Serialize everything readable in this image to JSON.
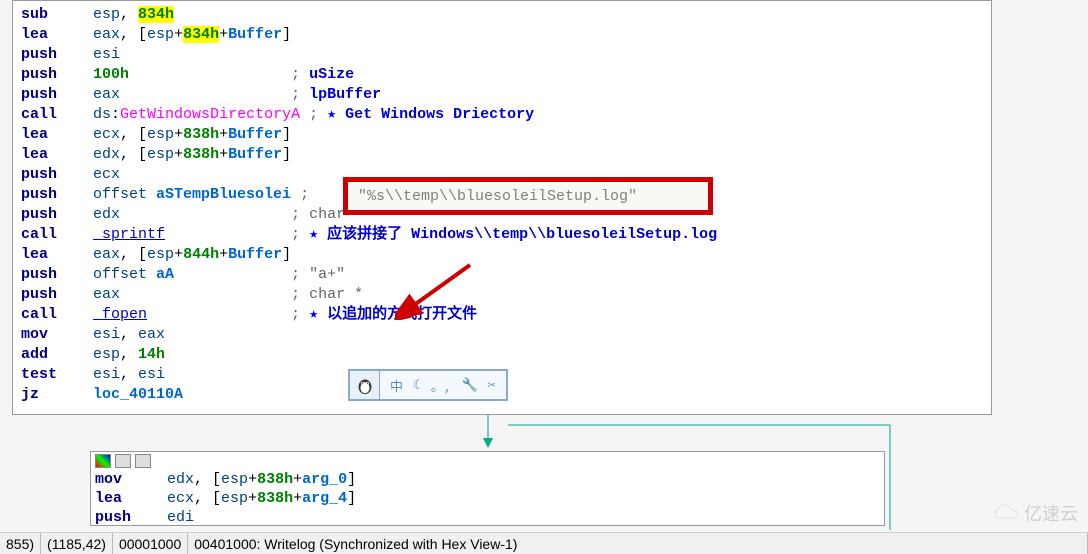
{
  "main": {
    "lines": [
      {
        "mn": "sub",
        "ops": [
          {
            "t": "reg",
            "v": "esp"
          },
          {
            "t": "p",
            "v": ", "
          },
          {
            "t": "hly",
            "v": "834h"
          }
        ]
      },
      {
        "mn": "lea",
        "ops": [
          {
            "t": "reg",
            "v": "eax"
          },
          {
            "t": "p",
            "v": ", ["
          },
          {
            "t": "reg",
            "v": "esp"
          },
          {
            "t": "p",
            "v": "+"
          },
          {
            "t": "hly",
            "v": "834h"
          },
          {
            "t": "p",
            "v": "+"
          },
          {
            "t": "id",
            "v": "Buffer"
          },
          {
            "t": "p",
            "v": "]"
          }
        ]
      },
      {
        "mn": "push",
        "ops": [
          {
            "t": "reg",
            "v": "esi"
          }
        ]
      },
      {
        "mn": "push",
        "ops": [
          {
            "t": "num",
            "v": "100h"
          }
        ],
        "cmt": {
          "sym": ";",
          "txt": "uSize",
          "style": "blue"
        }
      },
      {
        "mn": "push",
        "ops": [
          {
            "t": "reg",
            "v": "eax"
          }
        ],
        "cmt": {
          "sym": ";",
          "txt": "lpBuffer",
          "style": "blue"
        }
      },
      {
        "mn": "call",
        "ops": [
          {
            "t": "reg",
            "v": "ds"
          },
          {
            "t": "p",
            "v": ":"
          },
          {
            "t": "api",
            "v": "GetWindowsDirectoryA"
          }
        ],
        "cmt": {
          "sym": ";",
          "star": true,
          "txt": "Get Windows Driectory",
          "style": "blue"
        }
      },
      {
        "mn": "lea",
        "ops": [
          {
            "t": "reg",
            "v": "ecx"
          },
          {
            "t": "p",
            "v": ", ["
          },
          {
            "t": "reg",
            "v": "esp"
          },
          {
            "t": "p",
            "v": "+"
          },
          {
            "t": "num",
            "v": "838h"
          },
          {
            "t": "p",
            "v": "+"
          },
          {
            "t": "id",
            "v": "Buffer"
          },
          {
            "t": "p",
            "v": "]"
          }
        ]
      },
      {
        "mn": "lea",
        "ops": [
          {
            "t": "reg",
            "v": "edx"
          },
          {
            "t": "p",
            "v": ", ["
          },
          {
            "t": "reg",
            "v": "esp"
          },
          {
            "t": "p",
            "v": "+"
          },
          {
            "t": "num",
            "v": "838h"
          },
          {
            "t": "p",
            "v": "+"
          },
          {
            "t": "id",
            "v": "Buffer"
          },
          {
            "t": "p",
            "v": "]"
          }
        ]
      },
      {
        "mn": "push",
        "ops": [
          {
            "t": "reg",
            "v": "ecx"
          }
        ]
      },
      {
        "mn": "push",
        "ops": [
          {
            "t": "reg",
            "v": "offset "
          },
          {
            "t": "id",
            "v": "aSTempBluesolei"
          }
        ],
        "cmt": {
          "sym": ";"
        }
      },
      {
        "mn": "push",
        "ops": [
          {
            "t": "reg",
            "v": "edx"
          }
        ],
        "cmt": {
          "sym": ";",
          "txt": "char *",
          "style": "grey"
        }
      },
      {
        "mn": "call",
        "ops": [
          {
            "t": "fn",
            "v": "_sprintf"
          }
        ],
        "cmt": {
          "sym": ";",
          "star": true,
          "txt": "应该拼接了 Windows\\\\temp\\\\bluesoleilSetup.log",
          "style": "blue"
        }
      },
      {
        "mn": "lea",
        "ops": [
          {
            "t": "reg",
            "v": "eax"
          },
          {
            "t": "p",
            "v": ", ["
          },
          {
            "t": "reg",
            "v": "esp"
          },
          {
            "t": "p",
            "v": "+"
          },
          {
            "t": "num",
            "v": "844h"
          },
          {
            "t": "p",
            "v": "+"
          },
          {
            "t": "id",
            "v": "Buffer"
          },
          {
            "t": "p",
            "v": "]"
          }
        ]
      },
      {
        "mn": "push",
        "ops": [
          {
            "t": "reg",
            "v": "offset "
          },
          {
            "t": "id",
            "v": "aA"
          }
        ],
        "cmt": {
          "sym": ";",
          "txt": "\"a+\"",
          "style": "grey"
        }
      },
      {
        "mn": "push",
        "ops": [
          {
            "t": "reg",
            "v": "eax"
          }
        ],
        "cmt": {
          "sym": ";",
          "txt": "char *",
          "style": "grey"
        }
      },
      {
        "mn": "call",
        "ops": [
          {
            "t": "fn",
            "v": "_fopen"
          }
        ],
        "cmt": {
          "sym": ";",
          "star": true,
          "txt": "以追加的方式打开文件",
          "style": "blue"
        }
      },
      {
        "mn": "mov",
        "ops": [
          {
            "t": "reg",
            "v": "esi"
          },
          {
            "t": "p",
            "v": ", "
          },
          {
            "t": "reg",
            "v": "eax"
          }
        ]
      },
      {
        "mn": "add",
        "ops": [
          {
            "t": "reg",
            "v": "esp"
          },
          {
            "t": "p",
            "v": ", "
          },
          {
            "t": "num",
            "v": "14h"
          }
        ]
      },
      {
        "mn": "test",
        "ops": [
          {
            "t": "reg",
            "v": "esi"
          },
          {
            "t": "p",
            "v": ", "
          },
          {
            "t": "reg",
            "v": "esi"
          }
        ]
      },
      {
        "mn": "jz",
        "ops": [
          {
            "t": "id",
            "v": "loc_40110A"
          }
        ]
      }
    ]
  },
  "tooltip": "\"%s\\\\temp\\\\bluesoleilSetup.log\"",
  "second": {
    "lines": [
      {
        "mn": "mov",
        "ops": [
          {
            "t": "reg",
            "v": "edx"
          },
          {
            "t": "p",
            "v": ", ["
          },
          {
            "t": "reg",
            "v": "esp"
          },
          {
            "t": "p",
            "v": "+"
          },
          {
            "t": "num",
            "v": "838h"
          },
          {
            "t": "p",
            "v": "+"
          },
          {
            "t": "id",
            "v": "arg_0"
          },
          {
            "t": "p",
            "v": "]"
          }
        ]
      },
      {
        "mn": "lea",
        "ops": [
          {
            "t": "reg",
            "v": "ecx"
          },
          {
            "t": "p",
            "v": ", ["
          },
          {
            "t": "reg",
            "v": "esp"
          },
          {
            "t": "p",
            "v": "+"
          },
          {
            "t": "num",
            "v": "838h"
          },
          {
            "t": "p",
            "v": "+"
          },
          {
            "t": "id",
            "v": "arg_4"
          },
          {
            "t": "p",
            "v": "]"
          }
        ]
      },
      {
        "mn": "push",
        "ops": [
          {
            "t": "reg",
            "v": "edi"
          }
        ]
      }
    ]
  },
  "ime": {
    "char": "中",
    "icons": [
      "☾",
      "。,",
      "🔧",
      "✂"
    ]
  },
  "status": {
    "c1": "855)",
    "c2": "(1185,42)",
    "c3": "00001000",
    "c4": "00401000: Writelog (Synchronized with Hex View-1)"
  },
  "watermark": "亿速云"
}
